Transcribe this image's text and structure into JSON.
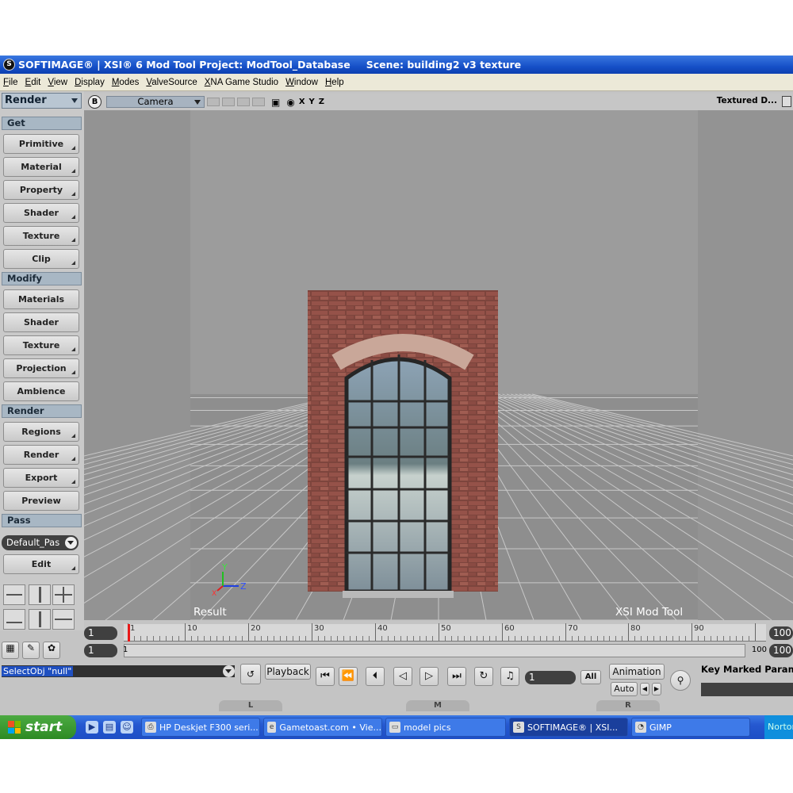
{
  "window": {
    "title": "SOFTIMAGE® | XSI® 6 Mod Tool Project: ModTool_Database",
    "scene": "Scene: building2 v3  texture",
    "logo": "S"
  },
  "menu": [
    "File",
    "Edit",
    "View",
    "Display",
    "Modes",
    "ValveSource",
    "XNA Game Studio",
    "Window",
    "Help"
  ],
  "left_panel": {
    "mode": "Render",
    "sections": [
      {
        "title": "Get",
        "buttons": [
          "Primitive",
          "Material",
          "Property",
          "Shader",
          "Texture",
          "Clip"
        ]
      },
      {
        "title": "Modify",
        "buttons": [
          "Materials",
          "Shader",
          "Texture",
          "Projection",
          "Ambience"
        ]
      },
      {
        "title": "Render",
        "buttons": [
          "Regions",
          "Render",
          "Export",
          "Preview"
        ]
      },
      {
        "title": "Pass",
        "buttons": []
      }
    ],
    "pass_value": "Default_Pas",
    "pass_edit": "Edit"
  },
  "viewport": {
    "letter": "B",
    "camera": "Camera",
    "axes": [
      "X",
      "Y",
      "Z"
    ],
    "shading": "Textured D...",
    "label_left": "Result",
    "label_right": "XSI Mod Tool",
    "gizmo": {
      "x": "X",
      "y": "Y",
      "z": "Z"
    }
  },
  "timeline": {
    "start_frame": "1",
    "range_start": "1",
    "range_inner": "1",
    "end_frame": "100",
    "range_end": "100",
    "range_end_inner": "100",
    "ticks": [
      "1",
      "10",
      "20",
      "30",
      "40",
      "50",
      "60",
      "70",
      "80",
      "90"
    ]
  },
  "bottom": {
    "command": "SelectObj \"null\"",
    "playback": "Playback",
    "frame_value": "1",
    "all": "All",
    "animation": "Animation",
    "auto": "Auto",
    "key_marked": "Key Marked Parameters",
    "tabs": [
      "L",
      "M",
      "R"
    ]
  },
  "taskbar": {
    "start": "start",
    "tasks": [
      {
        "label": "HP Deskjet F300 seri...",
        "icon": "printer-icon"
      },
      {
        "label": "Gametoast.com • Vie...",
        "icon": "ie-icon"
      },
      {
        "label": "model pics",
        "icon": "folder-icon"
      },
      {
        "label": "SOFTIMAGE® | XSI...",
        "icon": "softimage-icon"
      },
      {
        "label": "GIMP",
        "icon": "gimp-icon"
      }
    ],
    "tray": "Norton"
  },
  "colors": {
    "titlebar": "#1650c8",
    "taskbar": "#2558d0",
    "start": "#2d8a23",
    "viewport": "#939393",
    "playhead": "#e81818",
    "brick": "#8a4d44"
  }
}
